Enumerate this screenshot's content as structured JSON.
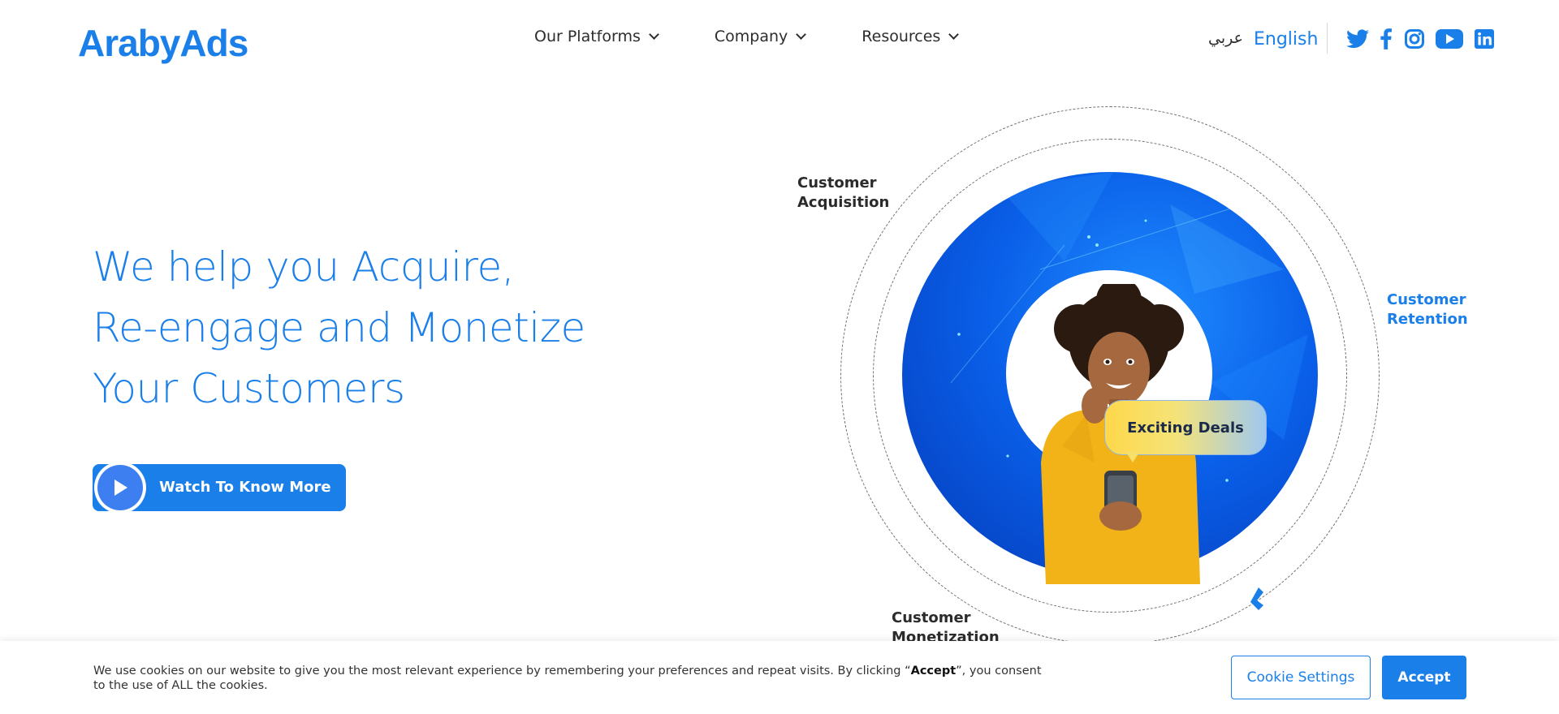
{
  "brand": {
    "name": "ArabyAds",
    "color": "#1a7fe8"
  },
  "nav": {
    "items": [
      {
        "label": "Our Platforms"
      },
      {
        "label": "Company"
      },
      {
        "label": "Resources"
      }
    ]
  },
  "language": {
    "arabic": "عربي",
    "english": "English"
  },
  "socials": [
    "twitter-icon",
    "facebook-icon",
    "instagram-icon",
    "youtube-icon",
    "linkedin-icon"
  ],
  "hero": {
    "headline": [
      "We help you Acquire,",
      "Re-engage and Monetize",
      "Your Customers"
    ],
    "cta_label": "Watch To Know More"
  },
  "graphic": {
    "bubble": "Exciting Deals",
    "labels": {
      "acquisition": "Customer\nAcquisition",
      "retention": "Customer\nRetention",
      "monetization": "Customer\nMonetization"
    }
  },
  "cookie": {
    "text_before": "We use cookies on our website to give you the most relevant experience by remembering your preferences and repeat visits. By clicking “",
    "text_bold": "Accept",
    "text_after": "”, you consent to the use of ALL the cookies.",
    "settings_label": "Cookie Settings",
    "accept_label": "Accept"
  }
}
